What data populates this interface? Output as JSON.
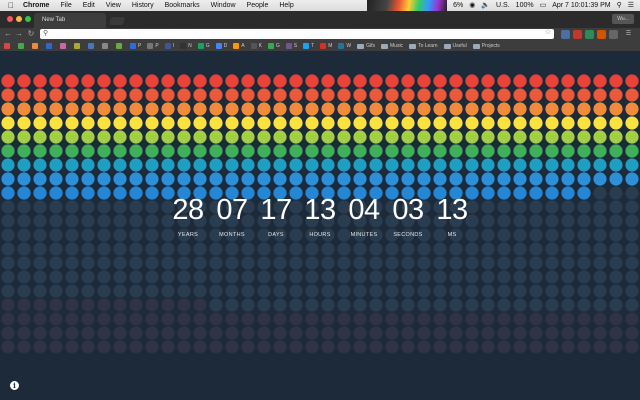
{
  "menubar": {
    "app": "Chrome",
    "items": [
      "File",
      "Edit",
      "View",
      "History",
      "Bookmarks",
      "Window",
      "People",
      "Help"
    ],
    "battery": "100%",
    "input_source": "U.S.",
    "wifi_level": "6%",
    "datetime": "Apr 7  10:01:39 PM"
  },
  "browser": {
    "tab_title": "New Tab",
    "profile_label": "Wu...",
    "omnibox_value": "",
    "bookmarks": [
      {
        "label": "P",
        "color": "#2d6cdf"
      },
      {
        "label": "P",
        "color": "#777777"
      },
      {
        "label": "I",
        "color": "#3b5998"
      },
      {
        "label": "N",
        "color": "#333333"
      },
      {
        "label": "G",
        "color": "#1aa260"
      },
      {
        "label": "D",
        "color": "#4285f4"
      },
      {
        "label": "A",
        "color": "#ff9900"
      },
      {
        "label": "K",
        "color": "#555555"
      },
      {
        "label": "G",
        "color": "#34a853"
      },
      {
        "label": "S",
        "color": "#6f5499"
      },
      {
        "label": "T",
        "color": "#1da1f2"
      },
      {
        "label": "M",
        "color": "#d93025"
      },
      {
        "label": "W",
        "color": "#21759b"
      }
    ],
    "folders": [
      "Gifs",
      "Music",
      "To Learn",
      "Useful",
      "Projects"
    ]
  },
  "countdown": {
    "units": [
      {
        "value": "28",
        "label": "YEARS"
      },
      {
        "value": "07",
        "label": "MONTHS"
      },
      {
        "value": "17",
        "label": "DAYS"
      },
      {
        "value": "13",
        "label": "HOURS"
      },
      {
        "value": "04",
        "label": "MINUTES"
      },
      {
        "value": "03",
        "label": "SECONDS"
      },
      {
        "value": "13",
        "label": "MS"
      }
    ]
  },
  "dot_grid": {
    "columns": 40,
    "rows": 20,
    "filled_rows": 9,
    "filled_in_last_row": 37,
    "row_colors": [
      "#e8423b",
      "#ea5a3a",
      "#f08a3c",
      "#f8e23f",
      "#a3cf45",
      "#3fb05a",
      "#1f9dc2",
      "#2c8fd8",
      "#2486d4"
    ],
    "empty_color": "#2a3c4f",
    "empty_color_dark": "#303246"
  },
  "colors": {
    "page_background": "#1c2a39",
    "text": "#ffffff"
  }
}
